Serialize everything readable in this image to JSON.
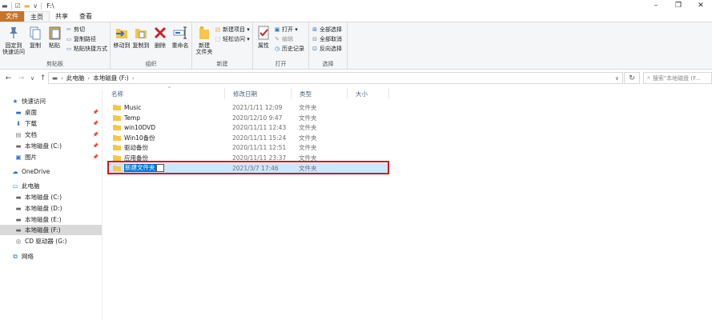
{
  "window": {
    "title": "F:\\",
    "controls": [
      "–",
      "❐",
      "✕"
    ]
  },
  "tabs": [
    {
      "label": "文件"
    },
    {
      "label": "主页"
    },
    {
      "label": "共享"
    },
    {
      "label": "查看"
    }
  ],
  "ribbon": {
    "clipboard": {
      "group_label": "剪贴板",
      "pin_label_1": "固定到",
      "pin_label_2": "快速访问",
      "copy": "复制",
      "paste": "粘贴",
      "cut": "剪切",
      "copy_path": "复制路径",
      "paste_shortcut": "粘贴快捷方式"
    },
    "organize": {
      "group_label": "组织",
      "move_to": "移动到",
      "copy_to": "复制到",
      "delete": "删除",
      "rename": "重命名"
    },
    "new": {
      "group_label": "新建",
      "new_folder_1": "新建",
      "new_folder_2": "文件夹",
      "new_item": "新建项目 ▾",
      "easy_access": "轻松访问 ▾"
    },
    "open": {
      "group_label": "打开",
      "properties": "属性",
      "open": "打开 ▾",
      "edit": "编辑",
      "history": "历史记录"
    },
    "select": {
      "group_label": "选择",
      "select_all": "全部选择",
      "select_none": "全部取消",
      "invert": "反向选择"
    }
  },
  "address": {
    "crumbs": [
      "此电脑",
      "本地磁盘 (F:)"
    ],
    "search_placeholder": "搜索\"本地磁盘 (F..."
  },
  "nav": {
    "quick_access": "快速访问",
    "desktop": "桌面",
    "downloads": "下载",
    "documents": "文档",
    "local_c_qa": "本地磁盘 (C:)",
    "pictures": "图片",
    "onedrive": "OneDrive",
    "this_pc": "此电脑",
    "drive_c": "本地磁盘 (C:)",
    "drive_d": "本地磁盘 (D:)",
    "drive_e": "本地磁盘 (E:)",
    "drive_f": "本地磁盘 (F:)",
    "drive_g": "CD 驱动器 (G:)",
    "network": "网络"
  },
  "columns": {
    "name": "名称",
    "date": "修改日期",
    "type": "类型",
    "size": "大小"
  },
  "files": [
    {
      "name": "Music",
      "date": "2021/1/11 12:09",
      "type": "文件夹"
    },
    {
      "name": "Temp",
      "date": "2020/12/10 9:47",
      "type": "文件夹"
    },
    {
      "name": "win10DVD",
      "date": "2020/11/11 12:43",
      "type": "文件夹"
    },
    {
      "name": "Win10备份",
      "date": "2020/11/11 15:24",
      "type": "文件夹"
    },
    {
      "name": "驱动备份",
      "date": "2020/11/11 12:51",
      "type": "文件夹"
    },
    {
      "name": "应用备份",
      "date": "2020/11/11 23:37",
      "type": "文件夹"
    }
  ],
  "new_folder": {
    "name": "新建文件夹",
    "date": "2021/3/7 17:46",
    "type": "文件夹"
  },
  "colors": {
    "folder": "#f6c64a",
    "highlight": "#d0191f",
    "selection": "#0078d7",
    "file_tab": "#c7742b"
  }
}
